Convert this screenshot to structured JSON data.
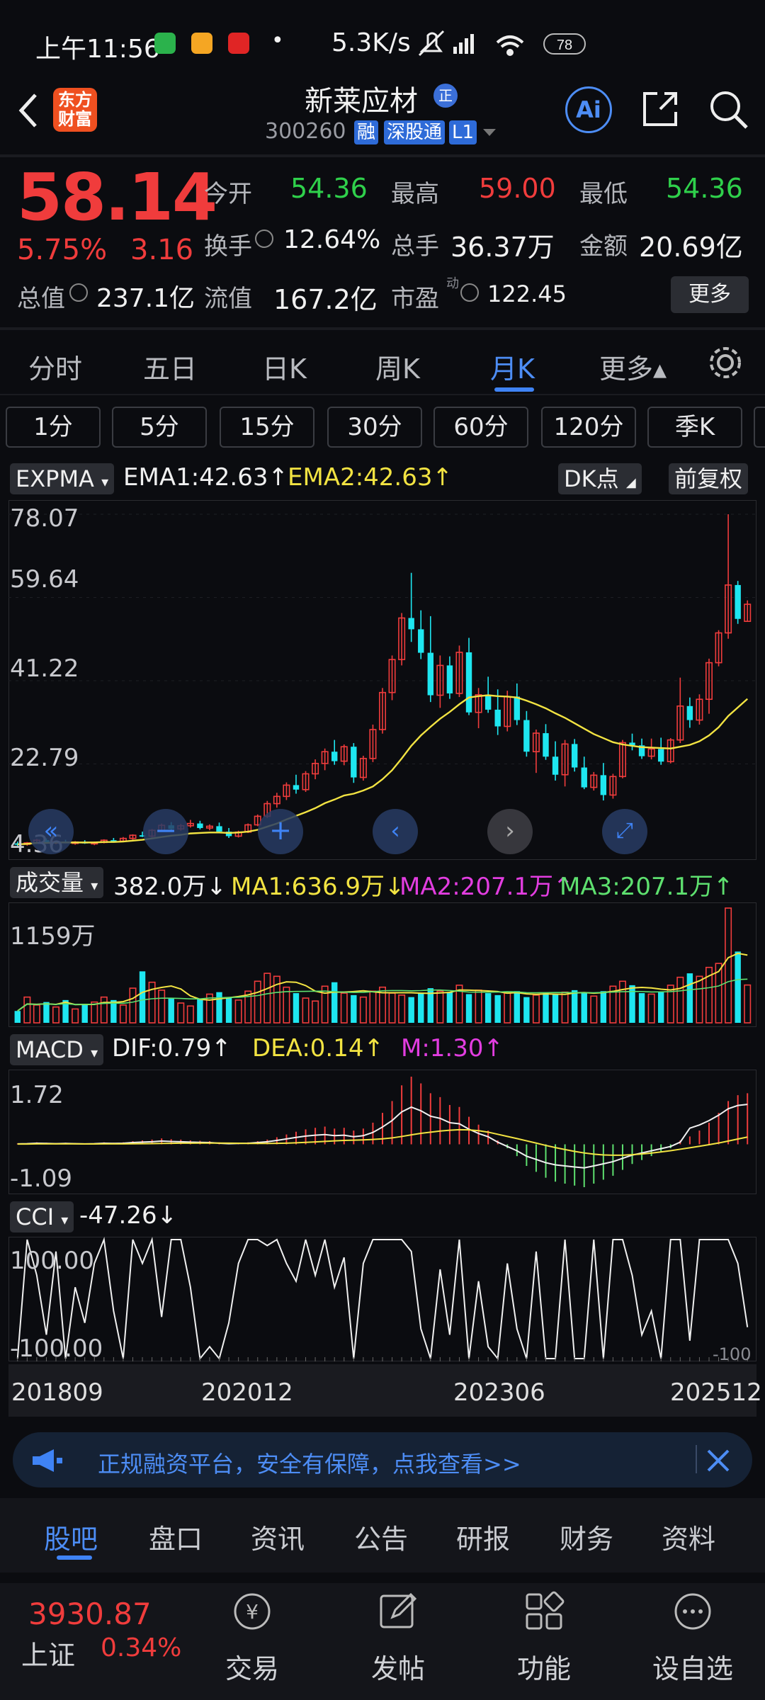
{
  "status_bar": {
    "time": "上午11:56",
    "speed": "5.3K/s",
    "battery": "78"
  },
  "header": {
    "logo_text": "东方财富",
    "stock_name": "新莱应材",
    "name_badge": "正",
    "code": "300260",
    "tags": [
      "融",
      "深股通",
      "L1"
    ],
    "ai_label": "Ai"
  },
  "quote": {
    "price": "58.14",
    "change_pct": "5.75%",
    "change": "3.16",
    "open_label": "今开",
    "open": "54.36",
    "high_label": "最高",
    "high": "59.00",
    "low_label": "最低",
    "low": "54.36",
    "turnover_label": "换手",
    "turnover": "12.64%",
    "volume_label": "总手",
    "volume": "36.37万",
    "amount_label": "金额",
    "amount": "20.69亿",
    "mktcap_label": "总值",
    "mktcap": "237.1亿",
    "float_label": "流值",
    "float": "167.2亿",
    "pe_label": "市盈",
    "pe_sup": "动",
    "pe": "122.45",
    "more": "更多"
  },
  "period_tabs": [
    {
      "label": "分时"
    },
    {
      "label": "五日"
    },
    {
      "label": "日K"
    },
    {
      "label": "周K"
    },
    {
      "label": "月K",
      "active": true
    },
    {
      "label": "更多▴"
    }
  ],
  "interval_buttons": [
    "1分",
    "5分",
    "15分",
    "30分",
    "60分",
    "120分",
    "季K"
  ],
  "main_chart": {
    "indicator": "EXPMA",
    "ema1_label": "EMA1:42.63",
    "ema2_label": "EMA2:42.63",
    "dk": "DK点",
    "adjust": "前复权",
    "y_ticks": [
      "78.07",
      "59.64",
      "41.22",
      "22.79",
      "4.36"
    ]
  },
  "volume_panel": {
    "indicator": "成交量",
    "value": "382.0万",
    "ma1": "MA1:636.9万",
    "ma2": "MA2:207.1万",
    "ma3": "MA3:207.1万",
    "y_max": "1159万"
  },
  "macd_panel": {
    "indicator": "MACD",
    "dif": "DIF:0.79",
    "dea": "DEA:0.14",
    "m": "M:1.30",
    "y_top": "1.72",
    "y_bottom": "-1.09"
  },
  "cci_panel": {
    "indicator": "CCI",
    "value": "-47.26",
    "y_top": "100.00",
    "y_bottom": "-100.00",
    "right_label": "-100"
  },
  "x_axis": [
    "201809",
    "202012",
    "202306",
    "202512"
  ],
  "banner": {
    "text": "正规融资平台，安全有保障，点我查看>>"
  },
  "bottom_tabs": [
    {
      "label": "股吧",
      "active": true
    },
    {
      "label": "盘口"
    },
    {
      "label": "资讯"
    },
    {
      "label": "公告"
    },
    {
      "label": "研报"
    },
    {
      "label": "财务"
    },
    {
      "label": "资料"
    }
  ],
  "footer": {
    "index_value": "3930.87",
    "index_name": "上证",
    "index_pct": "0.34%",
    "items": [
      "交易",
      "发帖",
      "功能",
      "设自选"
    ]
  },
  "colors": {
    "up": "#f03c3c",
    "down": "#1ee6f0",
    "ema": "#f2e342",
    "accent": "#3f83f5"
  },
  "chart_data": {
    "type": "candlestick",
    "period": "monthly",
    "x_range": [
      "201809",
      "202512"
    ],
    "ylim": [
      4.36,
      78.07
    ],
    "candles": [
      [
        5.2,
        5.6,
        4.6,
        5.0
      ],
      [
        5.0,
        5.5,
        4.7,
        5.3
      ],
      [
        5.3,
        6.2,
        5.1,
        5.9
      ],
      [
        5.9,
        6.3,
        5.2,
        5.4
      ],
      [
        5.4,
        5.8,
        5.0,
        5.6
      ],
      [
        5.6,
        6.0,
        5.2,
        5.3
      ],
      [
        5.3,
        5.7,
        4.9,
        5.5
      ],
      [
        5.5,
        5.9,
        5.1,
        5.2
      ],
      [
        5.2,
        5.6,
        4.8,
        5.4
      ],
      [
        5.4,
        6.1,
        5.2,
        5.9
      ],
      [
        5.9,
        6.4,
        5.5,
        5.7
      ],
      [
        5.7,
        6.6,
        5.5,
        6.3
      ],
      [
        6.3,
        7.2,
        6.0,
        7.0
      ],
      [
        7.0,
        7.8,
        6.6,
        6.8
      ],
      [
        6.8,
        8.4,
        6.5,
        8.1
      ],
      [
        8.1,
        9.6,
        7.8,
        9.2
      ],
      [
        9.2,
        9.9,
        8.1,
        8.4
      ],
      [
        8.4,
        9.5,
        8.0,
        9.1
      ],
      [
        9.1,
        10.4,
        8.7,
        9.6
      ],
      [
        9.6,
        10.2,
        8.3,
        8.6
      ],
      [
        8.6,
        9.4,
        8.1,
        9.0
      ],
      [
        9.0,
        9.8,
        7.6,
        7.8
      ],
      [
        7.8,
        8.6,
        6.4,
        6.8
      ],
      [
        6.8,
        8.0,
        6.5,
        7.7
      ],
      [
        7.7,
        9.6,
        7.5,
        9.3
      ],
      [
        9.3,
        11.6,
        9.0,
        11.2
      ],
      [
        11.2,
        14.6,
        10.8,
        14.0
      ],
      [
        14.0,
        16.4,
        13.1,
        15.6
      ],
      [
        15.6,
        18.7,
        14.8,
        18.1
      ],
      [
        18.1,
        20.4,
        16.2,
        17.1
      ],
      [
        17.1,
        21.2,
        16.6,
        20.6
      ],
      [
        20.6,
        23.8,
        19.4,
        22.9
      ],
      [
        22.9,
        26.2,
        21.4,
        25.5
      ],
      [
        25.5,
        28.1,
        22.6,
        23.4
      ],
      [
        23.4,
        27.1,
        22.5,
        26.6
      ],
      [
        26.6,
        27.4,
        18.6,
        19.8
      ],
      [
        19.8,
        24.6,
        19.1,
        24.0
      ],
      [
        24.0,
        31.5,
        23.2,
        30.4
      ],
      [
        30.4,
        39.6,
        29.5,
        38.6
      ],
      [
        38.6,
        46.8,
        36.9,
        45.9
      ],
      [
        45.9,
        56.2,
        44.6,
        55.1
      ],
      [
        55.1,
        65.1,
        49.8,
        52.6
      ],
      [
        52.6,
        56.8,
        46.0,
        47.4
      ],
      [
        47.4,
        55.5,
        36.5,
        38.0
      ],
      [
        38.0,
        46.8,
        35.2,
        44.6
      ],
      [
        44.6,
        46.6,
        37.2,
        38.4
      ],
      [
        38.4,
        49.0,
        37.6,
        47.5
      ],
      [
        47.5,
        50.7,
        33.6,
        34.2
      ],
      [
        34.2,
        39.6,
        30.7,
        38.1
      ],
      [
        38.1,
        42.1,
        34.1,
        34.8
      ],
      [
        34.8,
        39.3,
        29.2,
        31.1
      ],
      [
        31.1,
        39.0,
        30.0,
        37.7
      ],
      [
        37.7,
        40.6,
        31.4,
        32.5
      ],
      [
        32.5,
        34.5,
        24.4,
        25.5
      ],
      [
        25.5,
        30.4,
        20.8,
        29.6
      ],
      [
        29.6,
        31.6,
        23.7,
        24.4
      ],
      [
        24.4,
        27.8,
        19.1,
        20.4
      ],
      [
        20.4,
        28.1,
        17.8,
        27.2
      ],
      [
        27.2,
        28.3,
        21.1,
        22.0
      ],
      [
        22.0,
        24.4,
        17.2,
        17.6
      ],
      [
        17.6,
        21.0,
        16.9,
        20.3
      ],
      [
        20.3,
        23.0,
        14.7,
        15.9
      ],
      [
        15.9,
        20.6,
        15.1,
        20.0
      ],
      [
        20.0,
        28.1,
        19.6,
        27.5
      ],
      [
        27.5,
        29.5,
        25.8,
        26.9
      ],
      [
        26.9,
        28.4,
        23.9,
        24.5
      ],
      [
        24.5,
        28.4,
        23.8,
        26.1
      ],
      [
        26.1,
        28.6,
        22.6,
        23.3
      ],
      [
        23.3,
        28.5,
        22.9,
        28.1
      ],
      [
        28.1,
        41.9,
        27.4,
        35.6
      ],
      [
        35.6,
        37.5,
        30.8,
        32.5
      ],
      [
        32.5,
        38.2,
        31.5,
        37.1
      ],
      [
        37.1,
        46.1,
        33.9,
        45.2
      ],
      [
        45.2,
        52.4,
        44.4,
        51.8
      ],
      [
        51.8,
        78.07,
        50.5,
        62.4
      ],
      [
        62.4,
        63.3,
        53.8,
        54.9
      ],
      [
        54.36,
        59.0,
        54.36,
        58.14
      ]
    ],
    "ema": [
      5.0,
      5.1,
      5.3,
      5.3,
      5.4,
      5.4,
      5.4,
      5.4,
      5.4,
      5.5,
      5.5,
      5.6,
      5.8,
      6.0,
      6.3,
      6.6,
      6.9,
      7.1,
      7.4,
      7.5,
      7.6,
      7.6,
      7.5,
      7.6,
      7.8,
      8.2,
      8.9,
      9.6,
      10.5,
      11.3,
      12.1,
      13.0,
      14.1,
      14.9,
      15.8,
      16.2,
      16.9,
      17.8,
      19.4,
      21.4,
      24.0,
      26.8,
      29.1,
      31.0,
      32.8,
      34.3,
      36.0,
      37.5,
      37.8,
      38.0,
      37.8,
      37.7,
      37.5,
      36.8,
      36.0,
      35.1,
      34.0,
      33.0,
      31.8,
      30.6,
      29.4,
      28.5,
      27.6,
      27.1,
      26.8,
      26.5,
      26.4,
      26.3,
      26.2,
      26.6,
      27.0,
      27.8,
      29.1,
      30.9,
      33.4,
      35.3,
      37.2
    ],
    "volume": [
      120,
      260,
      180,
      210,
      160,
      230,
      140,
      190,
      210,
      260,
      230,
      180,
      350,
      520,
      410,
      330,
      250,
      200,
      170,
      240,
      290,
      310,
      260,
      230,
      320,
      420,
      500,
      470,
      360,
      300,
      250,
      220,
      370,
      410,
      300,
      280,
      260,
      320,
      360,
      300,
      280,
      260,
      300,
      350,
      320,
      310,
      380,
      290,
      330,
      300,
      280,
      300,
      320,
      260,
      280,
      300,
      290,
      310,
      330,
      300,
      270,
      320,
      370,
      420,
      380,
      300,
      290,
      310,
      380,
      460,
      500,
      470,
      560,
      600,
      1159,
      720,
      382
    ],
    "macd_hist": [
      0.02,
      0.03,
      0.05,
      0.04,
      0.03,
      0.04,
      0.03,
      0.02,
      0.03,
      0.05,
      0.04,
      0.05,
      0.08,
      0.1,
      0.12,
      0.15,
      0.13,
      0.12,
      0.1,
      0.09,
      0.08,
      0.05,
      0.03,
      0.04,
      0.05,
      0.08,
      0.12,
      0.18,
      0.25,
      0.32,
      0.38,
      0.42,
      0.45,
      0.4,
      0.42,
      0.35,
      0.4,
      0.55,
      0.8,
      1.1,
      1.5,
      1.72,
      1.55,
      1.3,
      1.2,
      1.0,
      0.95,
      0.7,
      0.5,
      0.35,
      0.1,
      -0.1,
      -0.3,
      -0.55,
      -0.7,
      -0.85,
      -0.95,
      -1.0,
      -1.05,
      -1.09,
      -1.0,
      -0.9,
      -0.8,
      -0.65,
      -0.5,
      -0.4,
      -0.3,
      -0.2,
      -0.1,
      0.1,
      0.2,
      0.35,
      0.55,
      0.8,
      1.1,
      1.25,
      1.3
    ],
    "cci": [
      -100,
      100,
      40,
      -60,
      80,
      -100,
      20,
      -40,
      60,
      100,
      -20,
      -100,
      100,
      60,
      100,
      -30,
      100,
      100,
      20,
      -100,
      -80,
      -100,
      -40,
      60,
      100,
      100,
      90,
      100,
      60,
      30,
      100,
      40,
      100,
      20,
      70,
      -100,
      60,
      100,
      100,
      100,
      100,
      80,
      -50,
      -100,
      50,
      -60,
      100,
      -100,
      30,
      -80,
      -100,
      60,
      -50,
      -100,
      80,
      -100,
      -100,
      100,
      -100,
      -100,
      100,
      -100,
      100,
      100,
      40,
      -60,
      -20,
      -100,
      100,
      100,
      -70,
      100,
      100,
      100,
      100,
      60,
      -47.26
    ]
  }
}
